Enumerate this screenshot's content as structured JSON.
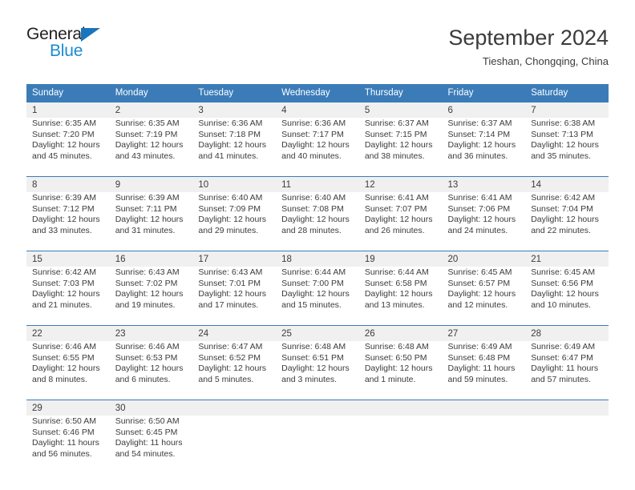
{
  "brand": {
    "word1": "General",
    "word2": "Blue",
    "triangle_color": "#1b75bc",
    "word2_color": "#1b8bd0"
  },
  "header": {
    "title": "September 2024",
    "subtitle": "Tieshan, Chongqing, China"
  },
  "theme": {
    "header_bg": "#3b7cb8",
    "daynum_bg": "#f0f0f0",
    "text": "#3b3b3b"
  },
  "weekday_headers": [
    "Sunday",
    "Monday",
    "Tuesday",
    "Wednesday",
    "Thursday",
    "Friday",
    "Saturday"
  ],
  "weeks": [
    [
      {
        "day": "1",
        "sunrise": "Sunrise: 6:35 AM",
        "sunset": "Sunset: 7:20 PM",
        "daylight1": "Daylight: 12 hours",
        "daylight2": "and 45 minutes."
      },
      {
        "day": "2",
        "sunrise": "Sunrise: 6:35 AM",
        "sunset": "Sunset: 7:19 PM",
        "daylight1": "Daylight: 12 hours",
        "daylight2": "and 43 minutes."
      },
      {
        "day": "3",
        "sunrise": "Sunrise: 6:36 AM",
        "sunset": "Sunset: 7:18 PM",
        "daylight1": "Daylight: 12 hours",
        "daylight2": "and 41 minutes."
      },
      {
        "day": "4",
        "sunrise": "Sunrise: 6:36 AM",
        "sunset": "Sunset: 7:17 PM",
        "daylight1": "Daylight: 12 hours",
        "daylight2": "and 40 minutes."
      },
      {
        "day": "5",
        "sunrise": "Sunrise: 6:37 AM",
        "sunset": "Sunset: 7:15 PM",
        "daylight1": "Daylight: 12 hours",
        "daylight2": "and 38 minutes."
      },
      {
        "day": "6",
        "sunrise": "Sunrise: 6:37 AM",
        "sunset": "Sunset: 7:14 PM",
        "daylight1": "Daylight: 12 hours",
        "daylight2": "and 36 minutes."
      },
      {
        "day": "7",
        "sunrise": "Sunrise: 6:38 AM",
        "sunset": "Sunset: 7:13 PM",
        "daylight1": "Daylight: 12 hours",
        "daylight2": "and 35 minutes."
      }
    ],
    [
      {
        "day": "8",
        "sunrise": "Sunrise: 6:39 AM",
        "sunset": "Sunset: 7:12 PM",
        "daylight1": "Daylight: 12 hours",
        "daylight2": "and 33 minutes."
      },
      {
        "day": "9",
        "sunrise": "Sunrise: 6:39 AM",
        "sunset": "Sunset: 7:11 PM",
        "daylight1": "Daylight: 12 hours",
        "daylight2": "and 31 minutes."
      },
      {
        "day": "10",
        "sunrise": "Sunrise: 6:40 AM",
        "sunset": "Sunset: 7:09 PM",
        "daylight1": "Daylight: 12 hours",
        "daylight2": "and 29 minutes."
      },
      {
        "day": "11",
        "sunrise": "Sunrise: 6:40 AM",
        "sunset": "Sunset: 7:08 PM",
        "daylight1": "Daylight: 12 hours",
        "daylight2": "and 28 minutes."
      },
      {
        "day": "12",
        "sunrise": "Sunrise: 6:41 AM",
        "sunset": "Sunset: 7:07 PM",
        "daylight1": "Daylight: 12 hours",
        "daylight2": "and 26 minutes."
      },
      {
        "day": "13",
        "sunrise": "Sunrise: 6:41 AM",
        "sunset": "Sunset: 7:06 PM",
        "daylight1": "Daylight: 12 hours",
        "daylight2": "and 24 minutes."
      },
      {
        "day": "14",
        "sunrise": "Sunrise: 6:42 AM",
        "sunset": "Sunset: 7:04 PM",
        "daylight1": "Daylight: 12 hours",
        "daylight2": "and 22 minutes."
      }
    ],
    [
      {
        "day": "15",
        "sunrise": "Sunrise: 6:42 AM",
        "sunset": "Sunset: 7:03 PM",
        "daylight1": "Daylight: 12 hours",
        "daylight2": "and 21 minutes."
      },
      {
        "day": "16",
        "sunrise": "Sunrise: 6:43 AM",
        "sunset": "Sunset: 7:02 PM",
        "daylight1": "Daylight: 12 hours",
        "daylight2": "and 19 minutes."
      },
      {
        "day": "17",
        "sunrise": "Sunrise: 6:43 AM",
        "sunset": "Sunset: 7:01 PM",
        "daylight1": "Daylight: 12 hours",
        "daylight2": "and 17 minutes."
      },
      {
        "day": "18",
        "sunrise": "Sunrise: 6:44 AM",
        "sunset": "Sunset: 7:00 PM",
        "daylight1": "Daylight: 12 hours",
        "daylight2": "and 15 minutes."
      },
      {
        "day": "19",
        "sunrise": "Sunrise: 6:44 AM",
        "sunset": "Sunset: 6:58 PM",
        "daylight1": "Daylight: 12 hours",
        "daylight2": "and 13 minutes."
      },
      {
        "day": "20",
        "sunrise": "Sunrise: 6:45 AM",
        "sunset": "Sunset: 6:57 PM",
        "daylight1": "Daylight: 12 hours",
        "daylight2": "and 12 minutes."
      },
      {
        "day": "21",
        "sunrise": "Sunrise: 6:45 AM",
        "sunset": "Sunset: 6:56 PM",
        "daylight1": "Daylight: 12 hours",
        "daylight2": "and 10 minutes."
      }
    ],
    [
      {
        "day": "22",
        "sunrise": "Sunrise: 6:46 AM",
        "sunset": "Sunset: 6:55 PM",
        "daylight1": "Daylight: 12 hours",
        "daylight2": "and 8 minutes."
      },
      {
        "day": "23",
        "sunrise": "Sunrise: 6:46 AM",
        "sunset": "Sunset: 6:53 PM",
        "daylight1": "Daylight: 12 hours",
        "daylight2": "and 6 minutes."
      },
      {
        "day": "24",
        "sunrise": "Sunrise: 6:47 AM",
        "sunset": "Sunset: 6:52 PM",
        "daylight1": "Daylight: 12 hours",
        "daylight2": "and 5 minutes."
      },
      {
        "day": "25",
        "sunrise": "Sunrise: 6:48 AM",
        "sunset": "Sunset: 6:51 PM",
        "daylight1": "Daylight: 12 hours",
        "daylight2": "and 3 minutes."
      },
      {
        "day": "26",
        "sunrise": "Sunrise: 6:48 AM",
        "sunset": "Sunset: 6:50 PM",
        "daylight1": "Daylight: 12 hours",
        "daylight2": "and 1 minute."
      },
      {
        "day": "27",
        "sunrise": "Sunrise: 6:49 AM",
        "sunset": "Sunset: 6:48 PM",
        "daylight1": "Daylight: 11 hours",
        "daylight2": "and 59 minutes."
      },
      {
        "day": "28",
        "sunrise": "Sunrise: 6:49 AM",
        "sunset": "Sunset: 6:47 PM",
        "daylight1": "Daylight: 11 hours",
        "daylight2": "and 57 minutes."
      }
    ],
    [
      {
        "day": "29",
        "sunrise": "Sunrise: 6:50 AM",
        "sunset": "Sunset: 6:46 PM",
        "daylight1": "Daylight: 11 hours",
        "daylight2": "and 56 minutes."
      },
      {
        "day": "30",
        "sunrise": "Sunrise: 6:50 AM",
        "sunset": "Sunset: 6:45 PM",
        "daylight1": "Daylight: 11 hours",
        "daylight2": "and 54 minutes."
      },
      {
        "day": "",
        "sunrise": "",
        "sunset": "",
        "daylight1": "",
        "daylight2": ""
      },
      {
        "day": "",
        "sunrise": "",
        "sunset": "",
        "daylight1": "",
        "daylight2": ""
      },
      {
        "day": "",
        "sunrise": "",
        "sunset": "",
        "daylight1": "",
        "daylight2": ""
      },
      {
        "day": "",
        "sunrise": "",
        "sunset": "",
        "daylight1": "",
        "daylight2": ""
      },
      {
        "day": "",
        "sunrise": "",
        "sunset": "",
        "daylight1": "",
        "daylight2": ""
      }
    ]
  ]
}
